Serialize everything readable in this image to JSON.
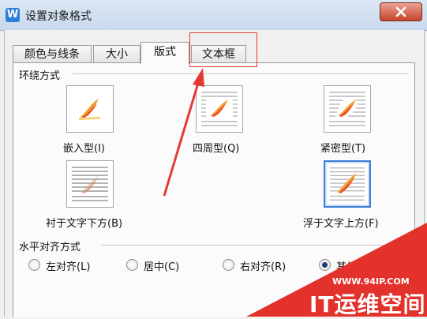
{
  "window": {
    "app_icon_letter": "W",
    "title": "设置对象格式",
    "close_icon": "close-icon"
  },
  "tabs": [
    {
      "label": "颜色与线条",
      "active": false
    },
    {
      "label": "大小",
      "active": false
    },
    {
      "label": "版式",
      "active": true
    },
    {
      "label": "文本框",
      "active": false
    }
  ],
  "wrap_section": {
    "title": "环绕方式",
    "options": [
      {
        "label": "嵌入型(I)",
        "selected": false
      },
      {
        "label": "四周型(Q)",
        "selected": false
      },
      {
        "label": "紧密型(T)",
        "selected": false
      },
      {
        "label": "衬于文字下方(B)",
        "selected": false
      },
      {
        "label": "浮于文字上方(F)",
        "selected": true
      }
    ]
  },
  "align_section": {
    "title": "水平对齐方式",
    "options": [
      {
        "label": "左对齐(L)",
        "checked": false
      },
      {
        "label": "居中(C)",
        "checked": false
      },
      {
        "label": "右对齐(R)",
        "checked": false
      },
      {
        "label": "其他",
        "checked": true
      }
    ]
  },
  "annotation": {
    "color": "#e53a33"
  },
  "watermark": {
    "url": "WWW.94IP.COM",
    "name": "IT运维空间",
    "color": "#e3312b"
  },
  "colors": {
    "selection_border": "#3d7bd6",
    "close_button": "#c8432b"
  }
}
